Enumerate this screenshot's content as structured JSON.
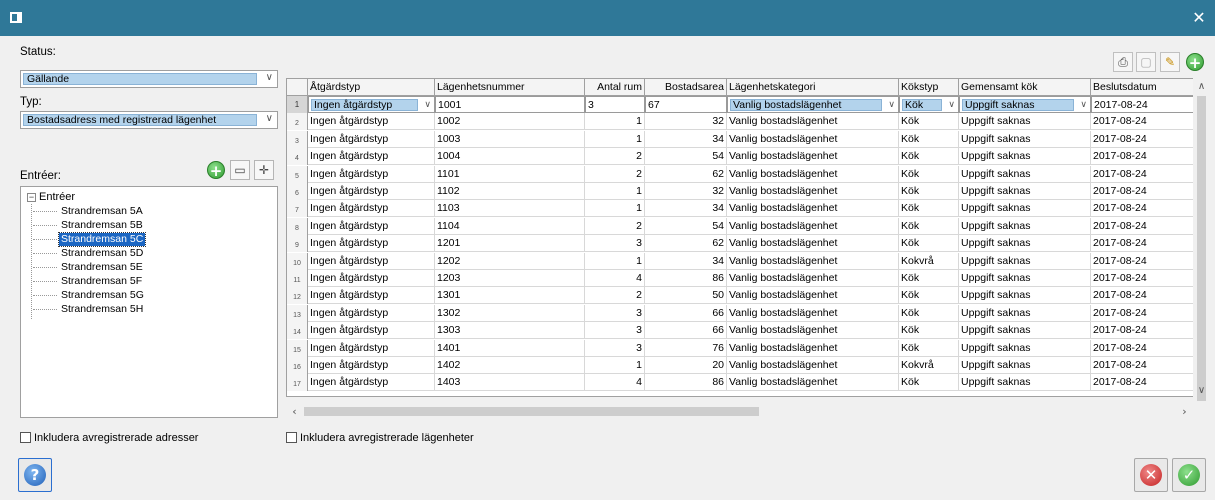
{
  "window": {
    "title": ""
  },
  "filters": {
    "status_label": "Status:",
    "status_value": "Gällande",
    "typ_label": "Typ:",
    "typ_value": "Bostadsadress med registrerad lägenhet",
    "entreer_label": "Entréer:"
  },
  "tree": {
    "root": "Entréer",
    "items": [
      "Strandremsan 5A",
      "Strandremsan 5B",
      "Strandremsan 5C",
      "Strandremsan 5D",
      "Strandremsan 5E",
      "Strandremsan 5F",
      "Strandremsan 5G",
      "Strandremsan 5H"
    ],
    "selected_index": 2
  },
  "checkboxes": {
    "include_addresses": "Inkludera avregistrerade adresser",
    "include_apartments": "Inkludera avregistrerade lägenheter"
  },
  "grid": {
    "columns": [
      "Åtgärdstyp",
      "Lägenhetsnummer",
      "Antal rum",
      "Bostadsarea",
      "Lägenhetskategori",
      "Kökstyp",
      "Gemensamt kök",
      "Beslutsdatum"
    ],
    "edit_row": {
      "row_no": "1",
      "atgardstyp": "Ingen åtgärdstyp",
      "nummer": "1001",
      "rum": "3",
      "area": "67",
      "kategori": "Vanlig bostadslägenhet",
      "kokstyp": "Kök",
      "gemensamt": "Uppgift saknas",
      "datum": "2017-08-24"
    },
    "rows": [
      [
        "2",
        "Ingen åtgärdstyp",
        "1002",
        "1",
        "32",
        "Vanlig bostadslägenhet",
        "Kök",
        "Uppgift saknas",
        "2017-08-24"
      ],
      [
        "3",
        "Ingen åtgärdstyp",
        "1003",
        "1",
        "34",
        "Vanlig bostadslägenhet",
        "Kök",
        "Uppgift saknas",
        "2017-08-24"
      ],
      [
        "4",
        "Ingen åtgärdstyp",
        "1004",
        "2",
        "54",
        "Vanlig bostadslägenhet",
        "Kök",
        "Uppgift saknas",
        "2017-08-24"
      ],
      [
        "5",
        "Ingen åtgärdstyp",
        "1101",
        "2",
        "62",
        "Vanlig bostadslägenhet",
        "Kök",
        "Uppgift saknas",
        "2017-08-24"
      ],
      [
        "6",
        "Ingen åtgärdstyp",
        "1102",
        "1",
        "32",
        "Vanlig bostadslägenhet",
        "Kök",
        "Uppgift saknas",
        "2017-08-24"
      ],
      [
        "7",
        "Ingen åtgärdstyp",
        "1103",
        "1",
        "34",
        "Vanlig bostadslägenhet",
        "Kök",
        "Uppgift saknas",
        "2017-08-24"
      ],
      [
        "8",
        "Ingen åtgärdstyp",
        "1104",
        "2",
        "54",
        "Vanlig bostadslägenhet",
        "Kök",
        "Uppgift saknas",
        "2017-08-24"
      ],
      [
        "9",
        "Ingen åtgärdstyp",
        "1201",
        "3",
        "62",
        "Vanlig bostadslägenhet",
        "Kök",
        "Uppgift saknas",
        "2017-08-24"
      ],
      [
        "10",
        "Ingen åtgärdstyp",
        "1202",
        "1",
        "34",
        "Vanlig bostadslägenhet",
        "Kokvrå",
        "Uppgift saknas",
        "2017-08-24"
      ],
      [
        "11",
        "Ingen åtgärdstyp",
        "1203",
        "4",
        "86",
        "Vanlig bostadslägenhet",
        "Kök",
        "Uppgift saknas",
        "2017-08-24"
      ],
      [
        "12",
        "Ingen åtgärdstyp",
        "1301",
        "2",
        "50",
        "Vanlig bostadslägenhet",
        "Kök",
        "Uppgift saknas",
        "2017-08-24"
      ],
      [
        "13",
        "Ingen åtgärdstyp",
        "1302",
        "3",
        "66",
        "Vanlig bostadslägenhet",
        "Kök",
        "Uppgift saknas",
        "2017-08-24"
      ],
      [
        "14",
        "Ingen åtgärdstyp",
        "1303",
        "3",
        "66",
        "Vanlig bostadslägenhet",
        "Kök",
        "Uppgift saknas",
        "2017-08-24"
      ],
      [
        "15",
        "Ingen åtgärdstyp",
        "1401",
        "3",
        "76",
        "Vanlig bostadslägenhet",
        "Kök",
        "Uppgift saknas",
        "2017-08-24"
      ],
      [
        "16",
        "Ingen åtgärdstyp",
        "1402",
        "1",
        "20",
        "Vanlig bostadslägenhet",
        "Kokvrå",
        "Uppgift saknas",
        "2017-08-24"
      ],
      [
        "17",
        "Ingen åtgärdstyp",
        "1403",
        "4",
        "86",
        "Vanlig bostadslägenhet",
        "Kök",
        "Uppgift saknas",
        "2017-08-24"
      ]
    ]
  },
  "icons": {
    "add": "plus-circle-icon",
    "rename": "rename-icon",
    "move": "move-icon",
    "print": "print-icon",
    "paste": "paste-icon",
    "edit": "pencil-icon",
    "help": "help-icon",
    "cancel": "cancel-icon",
    "ok": "ok-icon"
  },
  "colors": {
    "titlebar": "#2f7898",
    "selection": "#1b66c3",
    "combo_highlight": "#b3d3ec"
  }
}
